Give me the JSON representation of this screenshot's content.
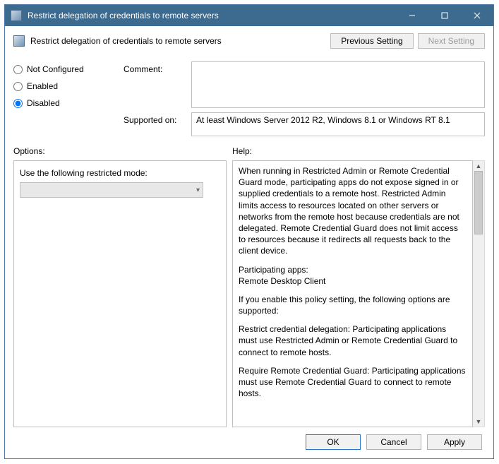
{
  "titlebar": {
    "title": "Restrict delegation of credentials to remote servers"
  },
  "header": {
    "setting_name": "Restrict delegation of credentials to remote servers",
    "previous": "Previous Setting",
    "next": "Next Setting"
  },
  "state": {
    "not_configured": "Not Configured",
    "enabled": "Enabled",
    "disabled": "Disabled"
  },
  "labels": {
    "comment": "Comment:",
    "supported_on": "Supported on:",
    "options": "Options:",
    "help": "Help:",
    "restricted_mode": "Use the following restricted mode:"
  },
  "supported_text": "At least Windows Server 2012 R2, Windows 8.1 or Windows RT 8.1",
  "help_paragraphs": [
    "When running in Restricted Admin or Remote Credential Guard mode, participating apps do not expose signed in or supplied credentials to a remote host. Restricted Admin limits access to resources located on other servers or networks from the remote host because credentials are not delegated. Remote Credential Guard does not limit access to resources because it redirects all requests back to the client device.",
    "Participating apps:\nRemote Desktop Client",
    "If you enable this policy setting, the following options are supported:",
    "Restrict credential delegation: Participating applications must use Restricted Admin or Remote Credential Guard to connect to remote hosts.",
    "Require Remote Credential Guard: Participating applications must use Remote Credential Guard to connect to remote hosts."
  ],
  "buttons": {
    "ok": "OK",
    "cancel": "Cancel",
    "apply": "Apply"
  }
}
